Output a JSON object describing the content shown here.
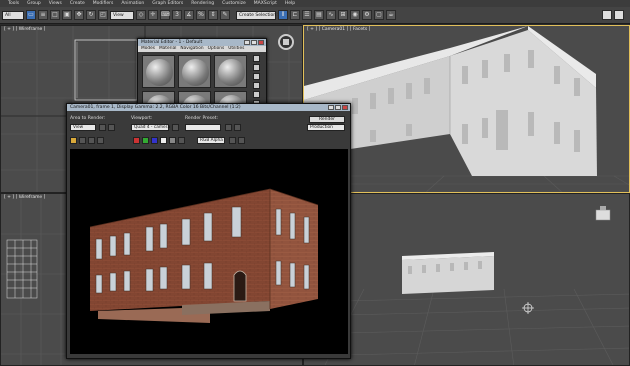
{
  "menubar": {
    "items": [
      "Tools",
      "Group",
      "Views",
      "Create",
      "Modifiers",
      "Animation",
      "Graph Editors",
      "Rendering",
      "Customize",
      "MAXScript",
      "Help"
    ]
  },
  "toolbar": {
    "select_filter": "All",
    "ref_coord": "View",
    "named_sel": "Create Selection Se"
  },
  "viewports": {
    "top_left": "[ + ] [ Wireframe ]",
    "top_right": "[ + ] [ Camera01 ] [ Facets ]",
    "bottom_left": "[ + ] [ Wireframe ]",
    "bottom_right": "[ + ]"
  },
  "material_editor": {
    "title": "Material Editor - 1 - Default",
    "menu": [
      "Modes",
      "Material",
      "Navigation",
      "Options",
      "Utilities"
    ]
  },
  "render_window": {
    "title": "Camera01, frame 1, Display Gamma: 2.2, RGBA Color 16 Bits/Channel (1:2)",
    "area_label": "Area to Render:",
    "area_value": "View",
    "viewport_label": "Viewport:",
    "viewport_value": "Quad 4 - camera 1",
    "preset_label": "Render Preset:",
    "preset_value": "",
    "render_button": "Render",
    "production_value": "Production",
    "channel_value": "RGB Alpha"
  },
  "colors": {
    "menubar": "#3c3c3c",
    "viewport": "#4b4b4b",
    "render_bg": "#000000",
    "brick": "#8a4a35",
    "accent_blue": "#3b6fb5"
  }
}
